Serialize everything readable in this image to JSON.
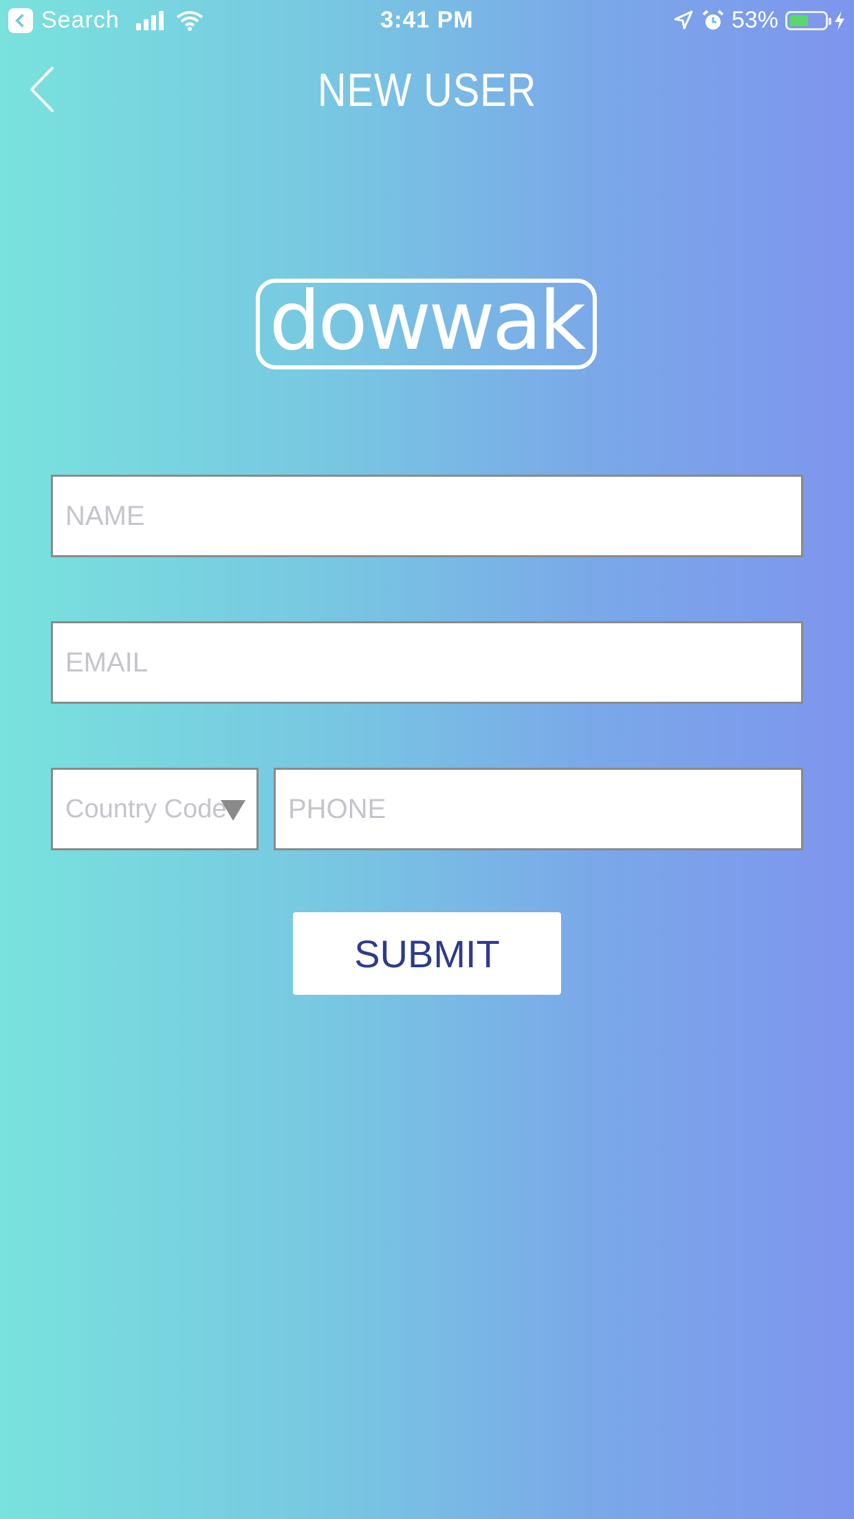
{
  "status_bar": {
    "back_app_label": "Search",
    "time": "3:41 PM",
    "battery_percent_label": "53%",
    "battery_level": 0.53
  },
  "header": {
    "title": "NEW USER",
    "back_icon": "chevron-left-icon"
  },
  "logo": {
    "text": "dowwak"
  },
  "form": {
    "name_placeholder": "NAME",
    "email_placeholder": "EMAIL",
    "country_code_placeholder": "Country Code",
    "phone_placeholder": "PHONE",
    "submit_label": "SUBMIT"
  },
  "colors": {
    "gradient_start": "#79e2dd",
    "gradient_end": "#7e95ed",
    "submit_text": "#2e3a8c",
    "field_border": "#8a8a8a"
  }
}
